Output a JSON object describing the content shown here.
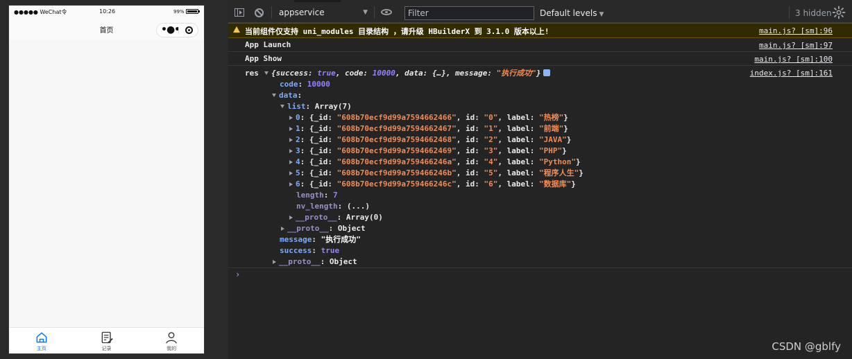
{
  "simulator": {
    "status_bar": {
      "carrier": "●●●●● WeChat令",
      "time": "10:26",
      "battery": "99%",
      "battery_level": 0.99
    },
    "nav_title": "首页",
    "tabs": [
      {
        "label": "主页",
        "icon": "home-icon",
        "active": true
      },
      {
        "label": "记录",
        "icon": "notes-icon",
        "active": false
      },
      {
        "label": "我的",
        "icon": "user-icon",
        "active": false
      }
    ],
    "colors": {
      "active_tab": "#007aff",
      "page_bg": "#f7f7f7"
    }
  },
  "toolbar": {
    "context": "appservice",
    "filter_placeholder": "Filter",
    "levels": "Default levels",
    "hidden": "3 hidden"
  },
  "console": {
    "warning": {
      "text": "当前组件仅支持 uni_modules 目录结构 ，请升级 HBuilderX 到 3.1.0 版本以上!",
      "source": "main.js? [sm]:96"
    },
    "logs": [
      {
        "text": "App Launch",
        "source": "main.js? [sm]:97"
      },
      {
        "text": "App Show",
        "source": "main.js? [sm]:100"
      }
    ],
    "res": {
      "label": "res",
      "source": "index.js? [sm]:161",
      "preview_open": "{",
      "preview_k1": "success",
      "preview_v1": "true",
      "preview_k2": "code",
      "preview_v2": "10000",
      "preview_k3": "data",
      "preview_v3": "{…}",
      "preview_k4": "message",
      "preview_v4": "\"执行成功\"",
      "preview_close": "}",
      "code_key": "code",
      "code_val": "10000",
      "data_key": "data",
      "list_key": "list",
      "list_val": "Array(7)",
      "items": [
        {
          "idx": "0",
          "_id": "\"608b70ecf9d99a7594662466\"",
          "id": "\"0\"",
          "label": "\"热榜\""
        },
        {
          "idx": "1",
          "_id": "\"608b70ecf9d99a7594662467\"",
          "id": "\"1\"",
          "label": "\"前端\""
        },
        {
          "idx": "2",
          "_id": "\"608b70ecf9d99a7594662468\"",
          "id": "\"2\"",
          "label": "\"JAVA\""
        },
        {
          "idx": "3",
          "_id": "\"608b70ecf9d99a7594662469\"",
          "id": "\"3\"",
          "label": "\"PHP\""
        },
        {
          "idx": "4",
          "_id": "\"608b70ecf9d99a759466246a\"",
          "id": "\"4\"",
          "label": "\"Python\""
        },
        {
          "idx": "5",
          "_id": "\"608b70ecf9d99a759466246b\"",
          "id": "\"5\"",
          "label": "\"程序人生\""
        },
        {
          "idx": "6",
          "_id": "\"608b70ecf9d99a759466246c\"",
          "id": "\"6\"",
          "label": "\"数据库\""
        }
      ],
      "length_key": "length",
      "length_val": "7",
      "nv_length_key": "nv_length",
      "nv_length_val": "(...)",
      "proto_key": "__proto__",
      "list_proto_val": "Array(0)",
      "data_proto_val": "Object",
      "message_key": "message",
      "message_val": "\"执行成功\"",
      "success_key": "success",
      "success_val": "true",
      "res_proto_val": "Object"
    },
    "prompt": "›"
  },
  "watermark": "CSDN @gblfy"
}
